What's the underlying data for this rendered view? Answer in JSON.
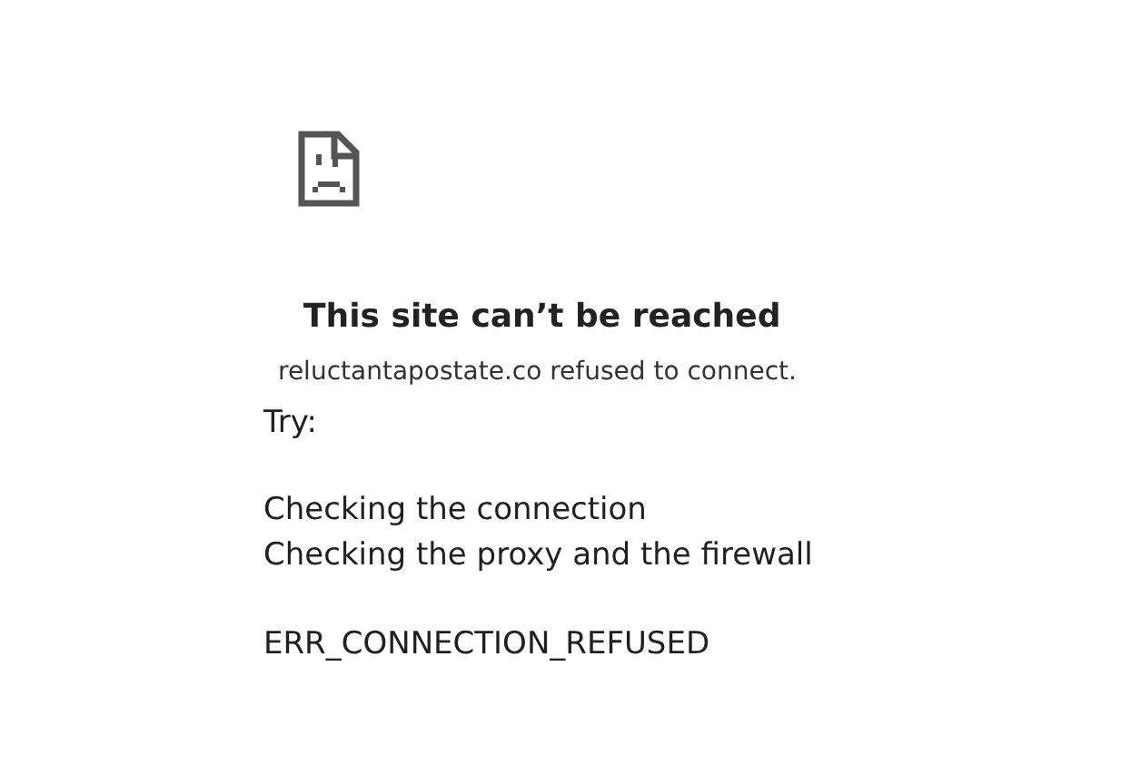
{
  "error_page": {
    "title": "This site can’t be reached",
    "message": "reluctantapostate.co refused to connect.",
    "try_label": "Try:",
    "suggestions": [
      "Checking the connection",
      "Checking the proxy and the firewall"
    ],
    "error_code": "ERR_CONNECTION_REFUSED"
  }
}
